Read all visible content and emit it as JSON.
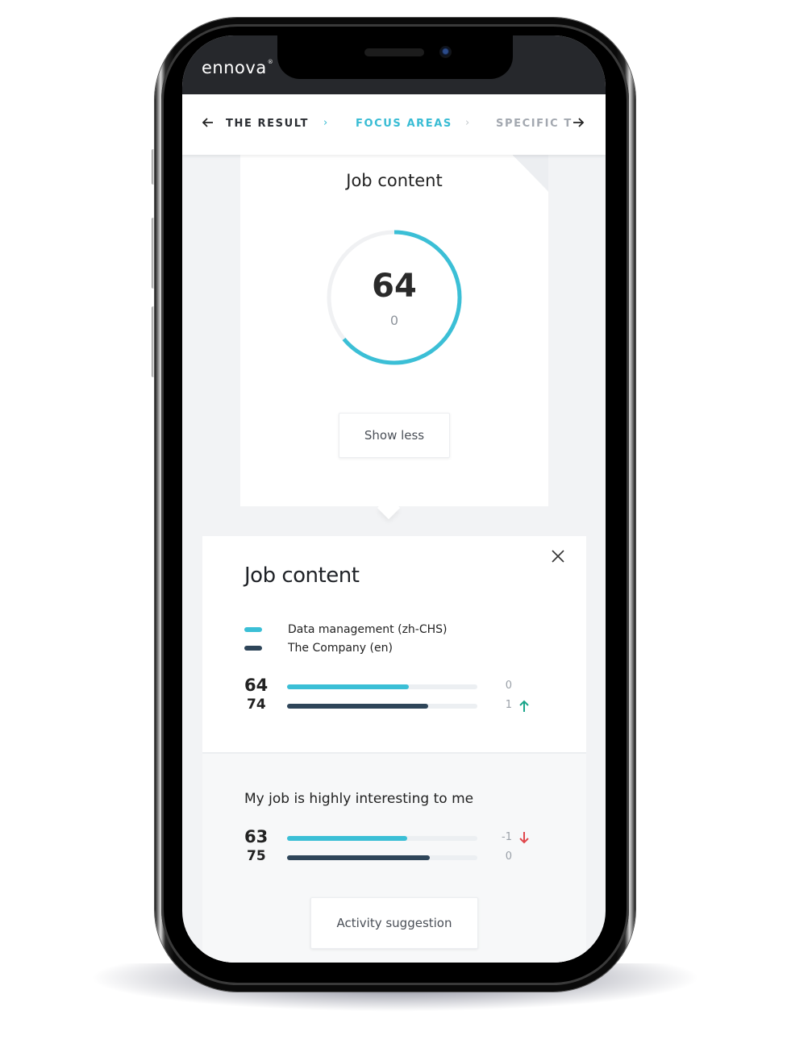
{
  "app": {
    "logo": "ennova",
    "logo_mark": "®"
  },
  "nav": {
    "prev_icon": "arrow-left-icon",
    "next_icon": "arrow-right-icon",
    "items": [
      {
        "label": "THE RESULT",
        "state": "visited",
        "color": "#2b2e33"
      },
      {
        "label": "FOCUS AREAS",
        "state": "active",
        "color": "#38bcd4"
      },
      {
        "label": "SPECIFIC T",
        "state": "upcoming",
        "color": "#a3a8b0"
      }
    ],
    "separator": "›"
  },
  "score_card": {
    "title": "Job content",
    "score": "64",
    "delta": "0",
    "gauge_fraction": 0.64,
    "show_less_label": "Show less"
  },
  "detail": {
    "title": "Job content",
    "close_icon": "close-icon",
    "legend": [
      {
        "label": "Data management (zh-CHS)",
        "color": "#3bbfd6"
      },
      {
        "label": "The Company (en)",
        "color": "#2e4559"
      }
    ],
    "summary": [
      {
        "value": "64",
        "percent": 64,
        "change": "0",
        "trend": "none",
        "color": "#3bbfd6"
      },
      {
        "value": "74",
        "percent": 74,
        "change": "1",
        "trend": "up",
        "color": "#2e4559"
      }
    ],
    "questions": [
      {
        "text": "My job is highly interesting to me",
        "rows": [
          {
            "value": "63",
            "percent": 63,
            "change": "-1",
            "trend": "down",
            "color": "#3bbfd6"
          },
          {
            "value": "75",
            "percent": 75,
            "change": "0",
            "trend": "none",
            "color": "#2e4559"
          }
        ]
      }
    ],
    "activity_button_label": "Activity suggestion"
  },
  "colors": {
    "accent": "#3bbfd6",
    "dark_series": "#2e4559",
    "trend_up": "#1aa58a",
    "trend_down": "#e0474c"
  }
}
